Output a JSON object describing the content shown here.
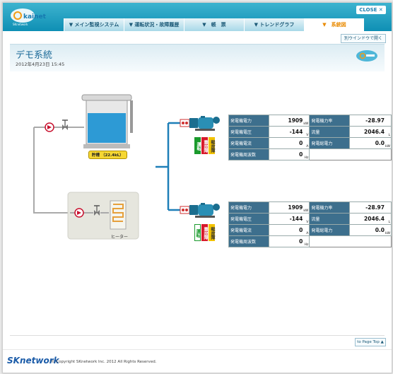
{
  "topbar": {
    "close_label": "CLOSE ✕",
    "logo_text": "Skainet"
  },
  "nav": {
    "tabs": [
      {
        "label": "▼ メイン監視システム"
      },
      {
        "label": "▼ 運転状況・故障履歴"
      },
      {
        "label": "▼　帳　票"
      },
      {
        "label": "▼ トレンドグラフ"
      },
      {
        "label": "▼　系統図"
      }
    ]
  },
  "new_window_label": "別ウインドウで開く",
  "page": {
    "title": "デモ系統",
    "date": "2012年4月23日 15:45"
  },
  "diagram": {
    "tank_label": "貯槽",
    "tank_value": "（22.4kL）",
    "heater_label": "ヒーター",
    "status_labels": {
      "run": "運転",
      "fault": "重故障",
      "light": "軽故障"
    },
    "colors": {
      "run": "#1a9a2c",
      "fault": "#d7182a",
      "light": "#f3c300",
      "pipe_blue": "#1e7fb8"
    },
    "pumps": [
      {
        "rows": [
          {
            "l1": "発電機電力",
            "v1": "1909",
            "u1": "kW",
            "l2": "発電機力率",
            "v2": "-28.97",
            "u2": ""
          },
          {
            "l1": "発電機電圧",
            "v1": "-144",
            "u1": "V",
            "l2": "流量",
            "v2": "2046.4",
            "u2": "L"
          },
          {
            "l1": "発電機電流",
            "v1": "0",
            "u1": "A",
            "l2": "発電総電力",
            "v2": "0.0",
            "u2": "kW"
          },
          {
            "l1": "発電機周波数",
            "v1": "0",
            "u1": "Hz"
          }
        ]
      },
      {
        "rows": [
          {
            "l1": "発電機電力",
            "v1": "1909",
            "u1": "kW",
            "l2": "発電機力率",
            "v2": "-28.97",
            "u2": ""
          },
          {
            "l1": "発電機電圧",
            "v1": "-144",
            "u1": "V",
            "l2": "流量",
            "v2": "2046.4",
            "u2": "L"
          },
          {
            "l1": "発電機電流",
            "v1": "0",
            "u1": "A",
            "l2": "発電総電力",
            "v2": "0.0",
            "u2": "kW"
          },
          {
            "l1": "発電機周波数",
            "v1": "0",
            "u1": "Hz"
          }
        ]
      }
    ]
  },
  "page_top_label": "to Page Top ▲",
  "footer": {
    "logo": "SKnetwork",
    "copyright": "© Copyright SKnetwork Inc. 2012 All Rights Reserved."
  }
}
